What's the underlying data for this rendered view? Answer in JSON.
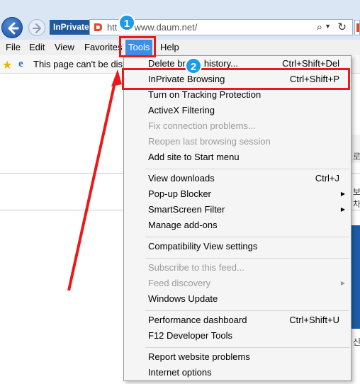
{
  "browser": {
    "inprivate_label": "InPrivate",
    "url": "http://www.daum.net/",
    "url_visible_start": "htt",
    "url_visible_end": "www.daum.net/"
  },
  "menubar": {
    "items": [
      "File",
      "Edit",
      "View",
      "Favorites",
      "Tools",
      "Help"
    ],
    "active": "Tools"
  },
  "favorites_bar": {
    "text": "This page can't be disp"
  },
  "tools_menu": {
    "items": [
      {
        "label": "Delete browsing history...",
        "label_visible": "Delete bro",
        "label_tail": "g history...",
        "shortcut": "Ctrl+Shift+Del",
        "disabled": false
      },
      {
        "label": "InPrivate Browsing",
        "shortcut": "Ctrl+Shift+P",
        "disabled": false
      },
      {
        "label": "Turn on Tracking Protection",
        "shortcut": "",
        "disabled": false
      },
      {
        "label": "ActiveX Filtering",
        "shortcut": "",
        "disabled": false
      },
      {
        "label": "Fix connection problems...",
        "shortcut": "",
        "disabled": true
      },
      {
        "label": "Reopen last browsing session",
        "shortcut": "",
        "disabled": true
      },
      {
        "label": "Add site to Start menu",
        "shortcut": "",
        "disabled": false
      },
      {
        "label": "View downloads",
        "shortcut": "Ctrl+J",
        "disabled": false
      },
      {
        "label": "Pop-up Blocker",
        "shortcut": "",
        "submenu": true,
        "disabled": false
      },
      {
        "label": "SmartScreen Filter",
        "shortcut": "",
        "submenu": true,
        "disabled": false
      },
      {
        "label": "Manage add-ons",
        "shortcut": "",
        "disabled": false
      },
      {
        "label": "Compatibility View settings",
        "shortcut": "",
        "disabled": false
      },
      {
        "label": "Subscribe to this feed...",
        "shortcut": "",
        "disabled": true
      },
      {
        "label": "Feed discovery",
        "shortcut": "",
        "submenu": true,
        "disabled": true
      },
      {
        "label": "Windows Update",
        "shortcut": "",
        "disabled": false
      },
      {
        "label": "Performance dashboard",
        "shortcut": "Ctrl+Shift+U",
        "disabled": false
      },
      {
        "label": "F12 Developer Tools",
        "shortcut": "",
        "disabled": false
      },
      {
        "label": "Report website problems",
        "shortcut": "",
        "disabled": false
      },
      {
        "label": "Internet options",
        "shortcut": "",
        "disabled": false
      }
    ]
  },
  "annotations": {
    "step1": "1",
    "step2": "2",
    "highlight_color": "#e81a1a",
    "badge_color": "#1e9be8"
  },
  "page_side_chars": [
    "로",
    "보차",
    "신"
  ]
}
